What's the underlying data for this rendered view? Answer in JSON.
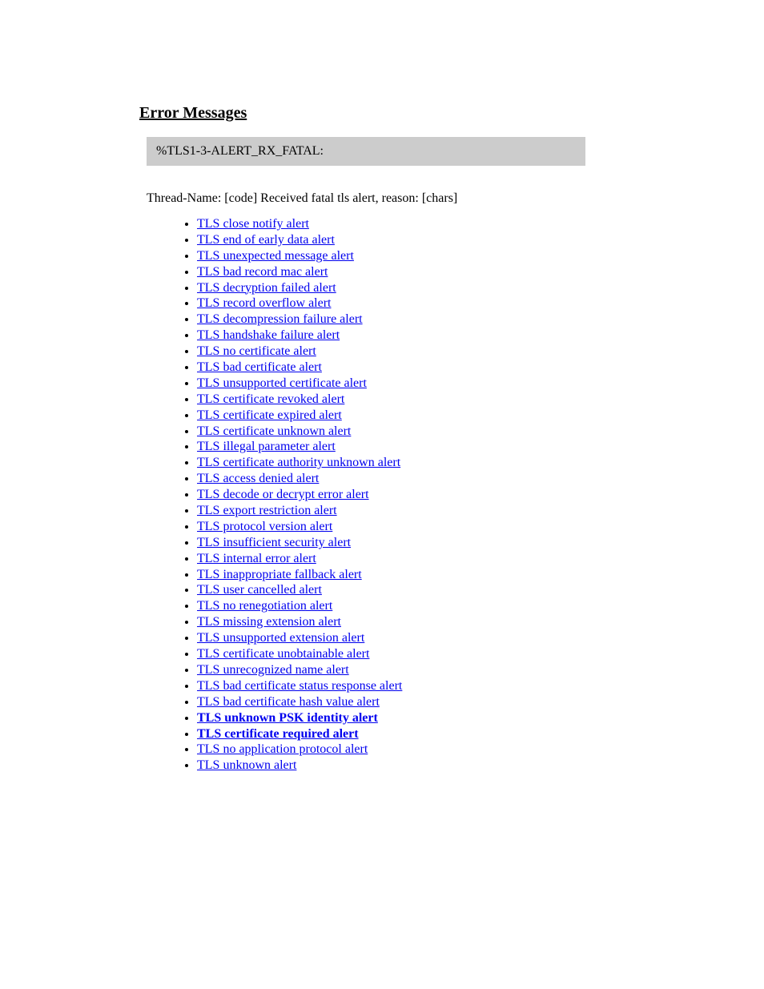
{
  "section_title": "Error Messages",
  "code_line": "%TLS1-3-ALERT_RX_FATAL:",
  "intro": "Thread-Name: [code] Received fatal tls alert, reason: [chars]",
  "links": [
    {
      "text": "TLS close notify alert"
    },
    {
      "text": "TLS end of early data alert"
    },
    {
      "text": "TLS unexpected message alert"
    },
    {
      "text": "TLS bad record mac alert"
    },
    {
      "text": "TLS decryption failed alert"
    },
    {
      "text": "TLS record overflow alert"
    },
    {
      "text": "TLS decompression failure alert"
    },
    {
      "text": "TLS handshake failure alert"
    },
    {
      "text": "TLS no certificate alert"
    },
    {
      "text": "TLS bad certificate alert"
    },
    {
      "text": "TLS unsupported certificate alert"
    },
    {
      "text": "TLS certificate revoked alert"
    },
    {
      "text": "TLS certificate expired alert"
    },
    {
      "text": "TLS certificate unknown alert"
    },
    {
      "text": "TLS illegal parameter alert"
    },
    {
      "text": "TLS certificate authority unknown alert"
    },
    {
      "text": "TLS access denied alert"
    },
    {
      "text": "TLS decode or decrypt error alert"
    },
    {
      "text": "TLS export restriction alert"
    },
    {
      "text": "TLS protocol version alert"
    },
    {
      "text": "TLS insufficient security alert"
    },
    {
      "text": "TLS internal error alert"
    },
    {
      "text": "TLS inappropriate fallback alert"
    },
    {
      "text": "TLS user cancelled alert"
    },
    {
      "text": "TLS no renegotiation alert"
    },
    {
      "text": "TLS missing extension alert"
    },
    {
      "text": "TLS unsupported extension alert"
    },
    {
      "text": "TLS certificate unobtainable alert"
    },
    {
      "text": "TLS unrecognized name alert"
    },
    {
      "text": "TLS bad certificate status response alert"
    },
    {
      "text": "TLS bad certificate hash value alert"
    },
    {
      "text": "TLS unknown PSK identity alert",
      "bold": true
    },
    {
      "text": "TLS certificate required alert",
      "bold": true
    },
    {
      "text": "TLS no application protocol alert"
    },
    {
      "text": "TLS unknown alert"
    }
  ]
}
